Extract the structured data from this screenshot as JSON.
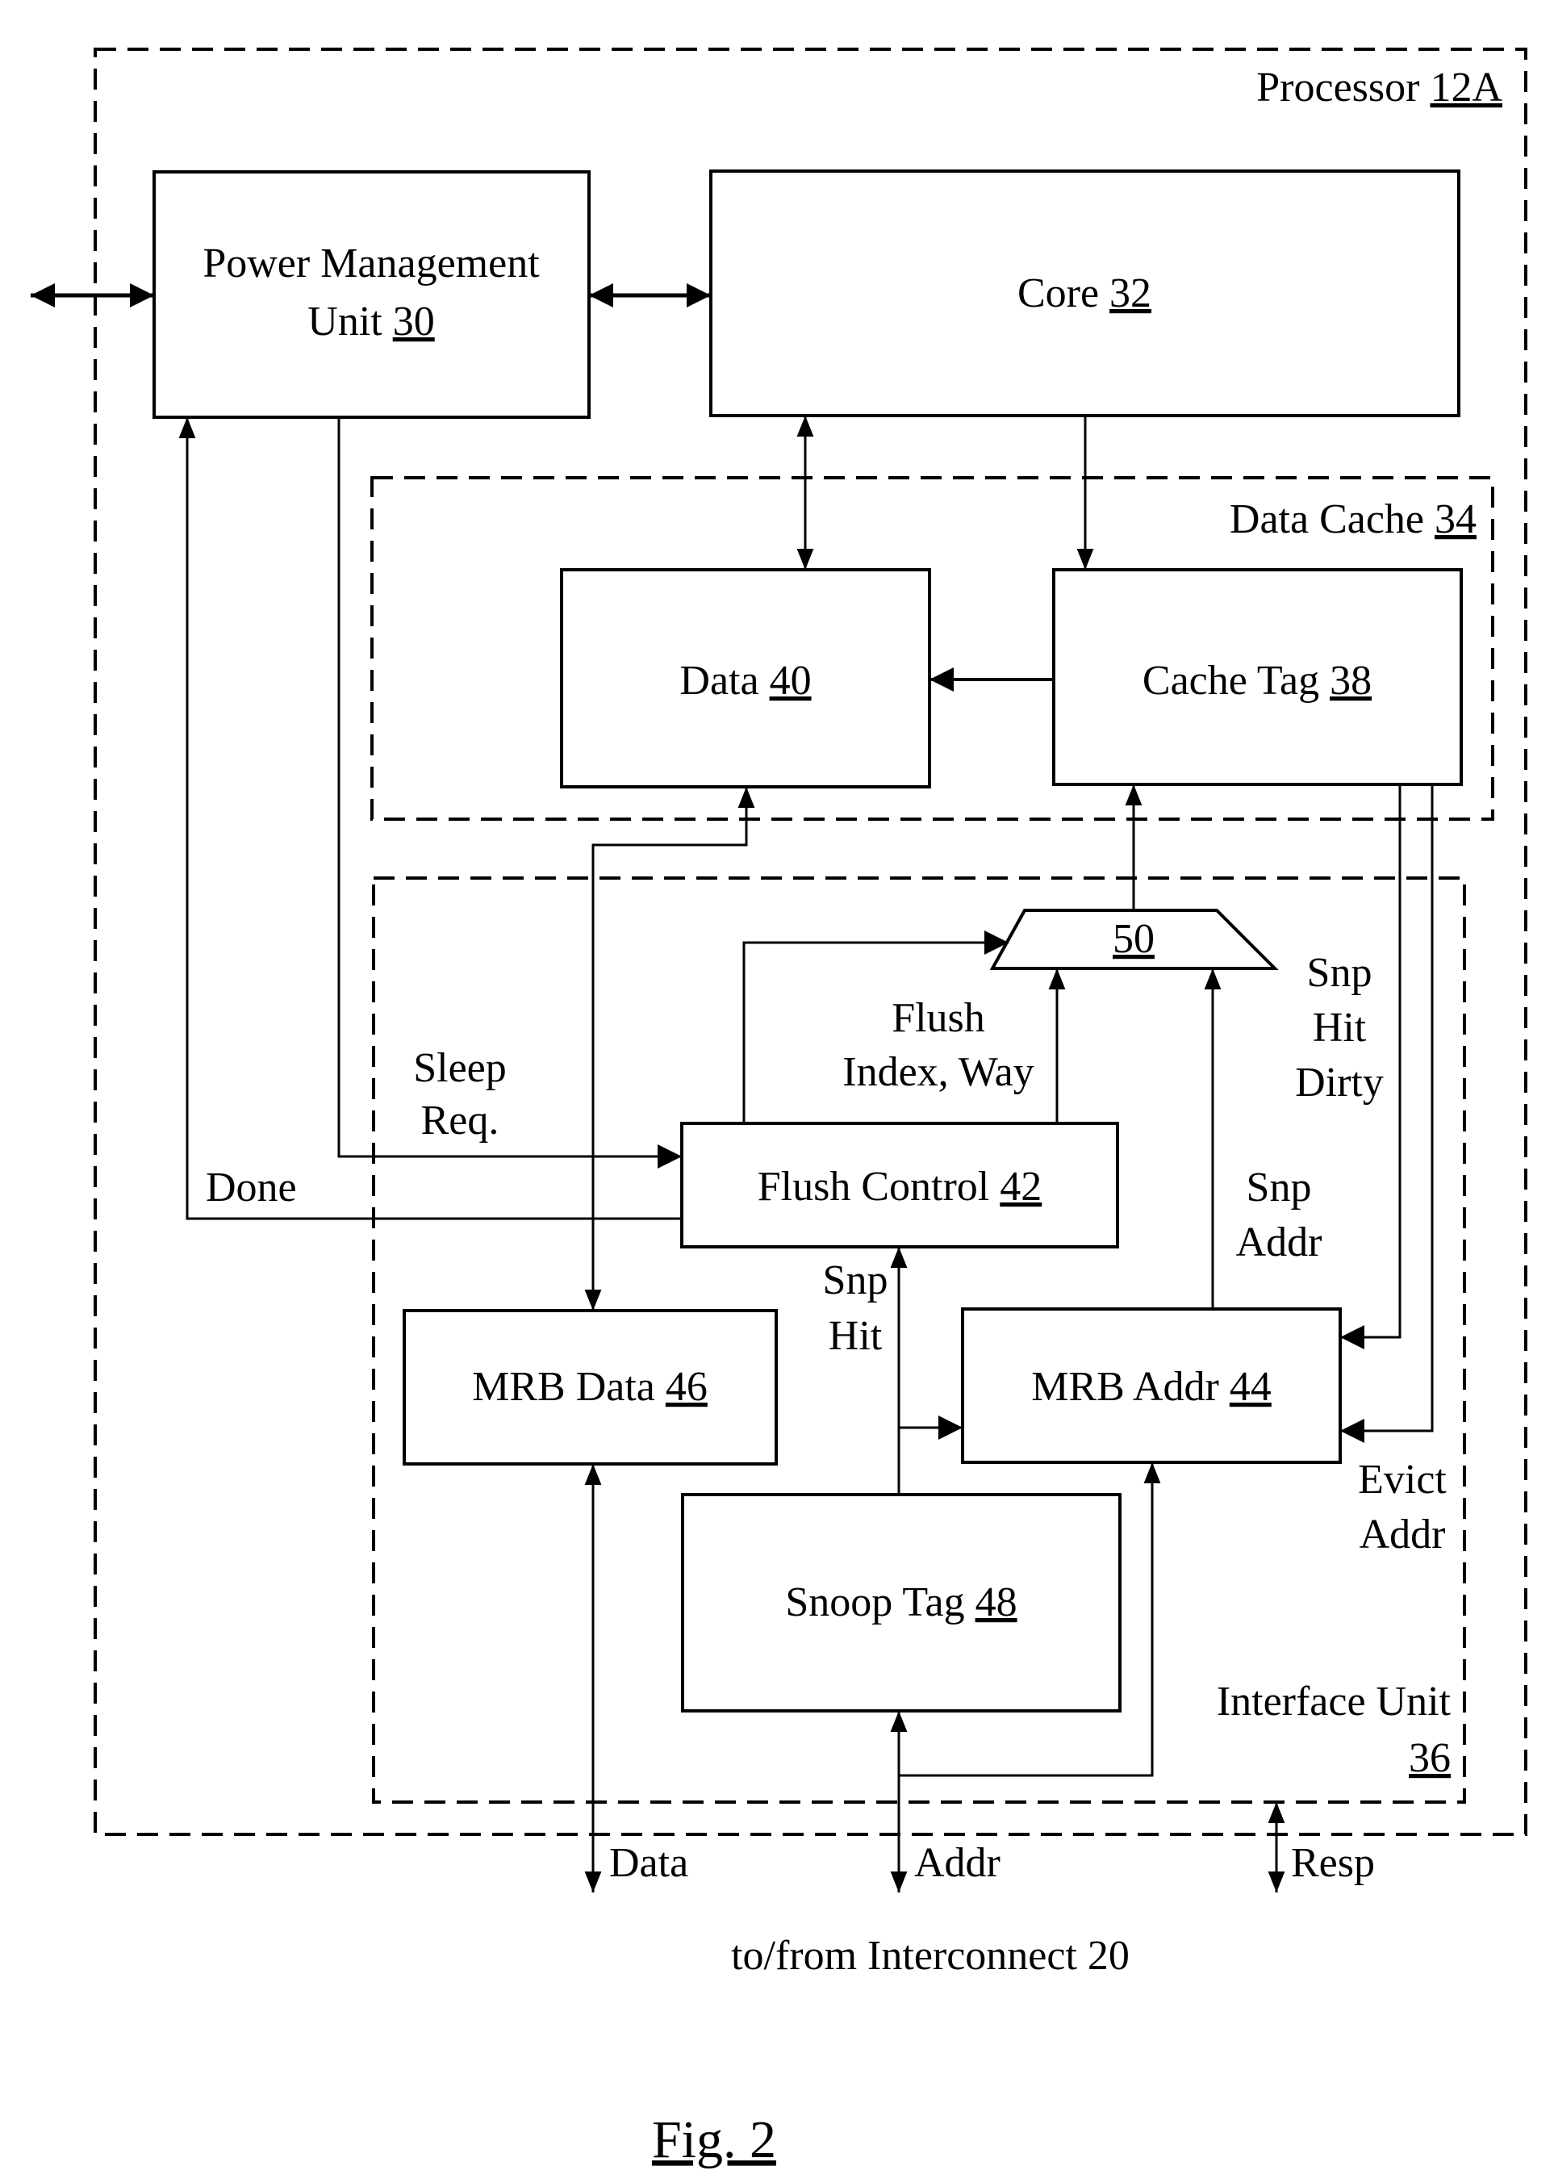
{
  "figure": {
    "caption": "Fig. 2",
    "footer": "to/from Interconnect 20"
  },
  "containers": {
    "processor": {
      "name": "Processor",
      "ref": "12A"
    },
    "data_cache": {
      "name": "Data Cache",
      "ref": "34"
    },
    "interface_unit": {
      "name": "Interface Unit",
      "ref": "36"
    }
  },
  "blocks": {
    "pmu": {
      "line1": "Power Management",
      "name": "Unit",
      "ref": "30"
    },
    "core": {
      "name": "Core",
      "ref": "32"
    },
    "data": {
      "name": "Data",
      "ref": "40"
    },
    "cache_tag": {
      "name": "Cache Tag",
      "ref": "38"
    },
    "mux": {
      "ref": "50"
    },
    "flush_control": {
      "name": "Flush Control",
      "ref": "42"
    },
    "mrb_data": {
      "name": "MRB Data",
      "ref": "46"
    },
    "mrb_addr": {
      "name": "MRB Addr",
      "ref": "44"
    },
    "snoop_tag": {
      "name": "Snoop Tag",
      "ref": "48"
    }
  },
  "signals": {
    "sleep": [
      "Sleep",
      "Req."
    ],
    "done": "Done",
    "flush_index": [
      "Flush",
      "Index, Way"
    ],
    "snp_hit_dirty": [
      "Snp",
      "Hit",
      "Dirty"
    ],
    "snp_addr": [
      "Snp",
      "Addr"
    ],
    "snp_hit": [
      "Snp",
      "Hit"
    ],
    "evict_addr": [
      "Evict",
      "Addr"
    ],
    "data": "Data",
    "addr": "Addr",
    "resp": "Resp"
  }
}
